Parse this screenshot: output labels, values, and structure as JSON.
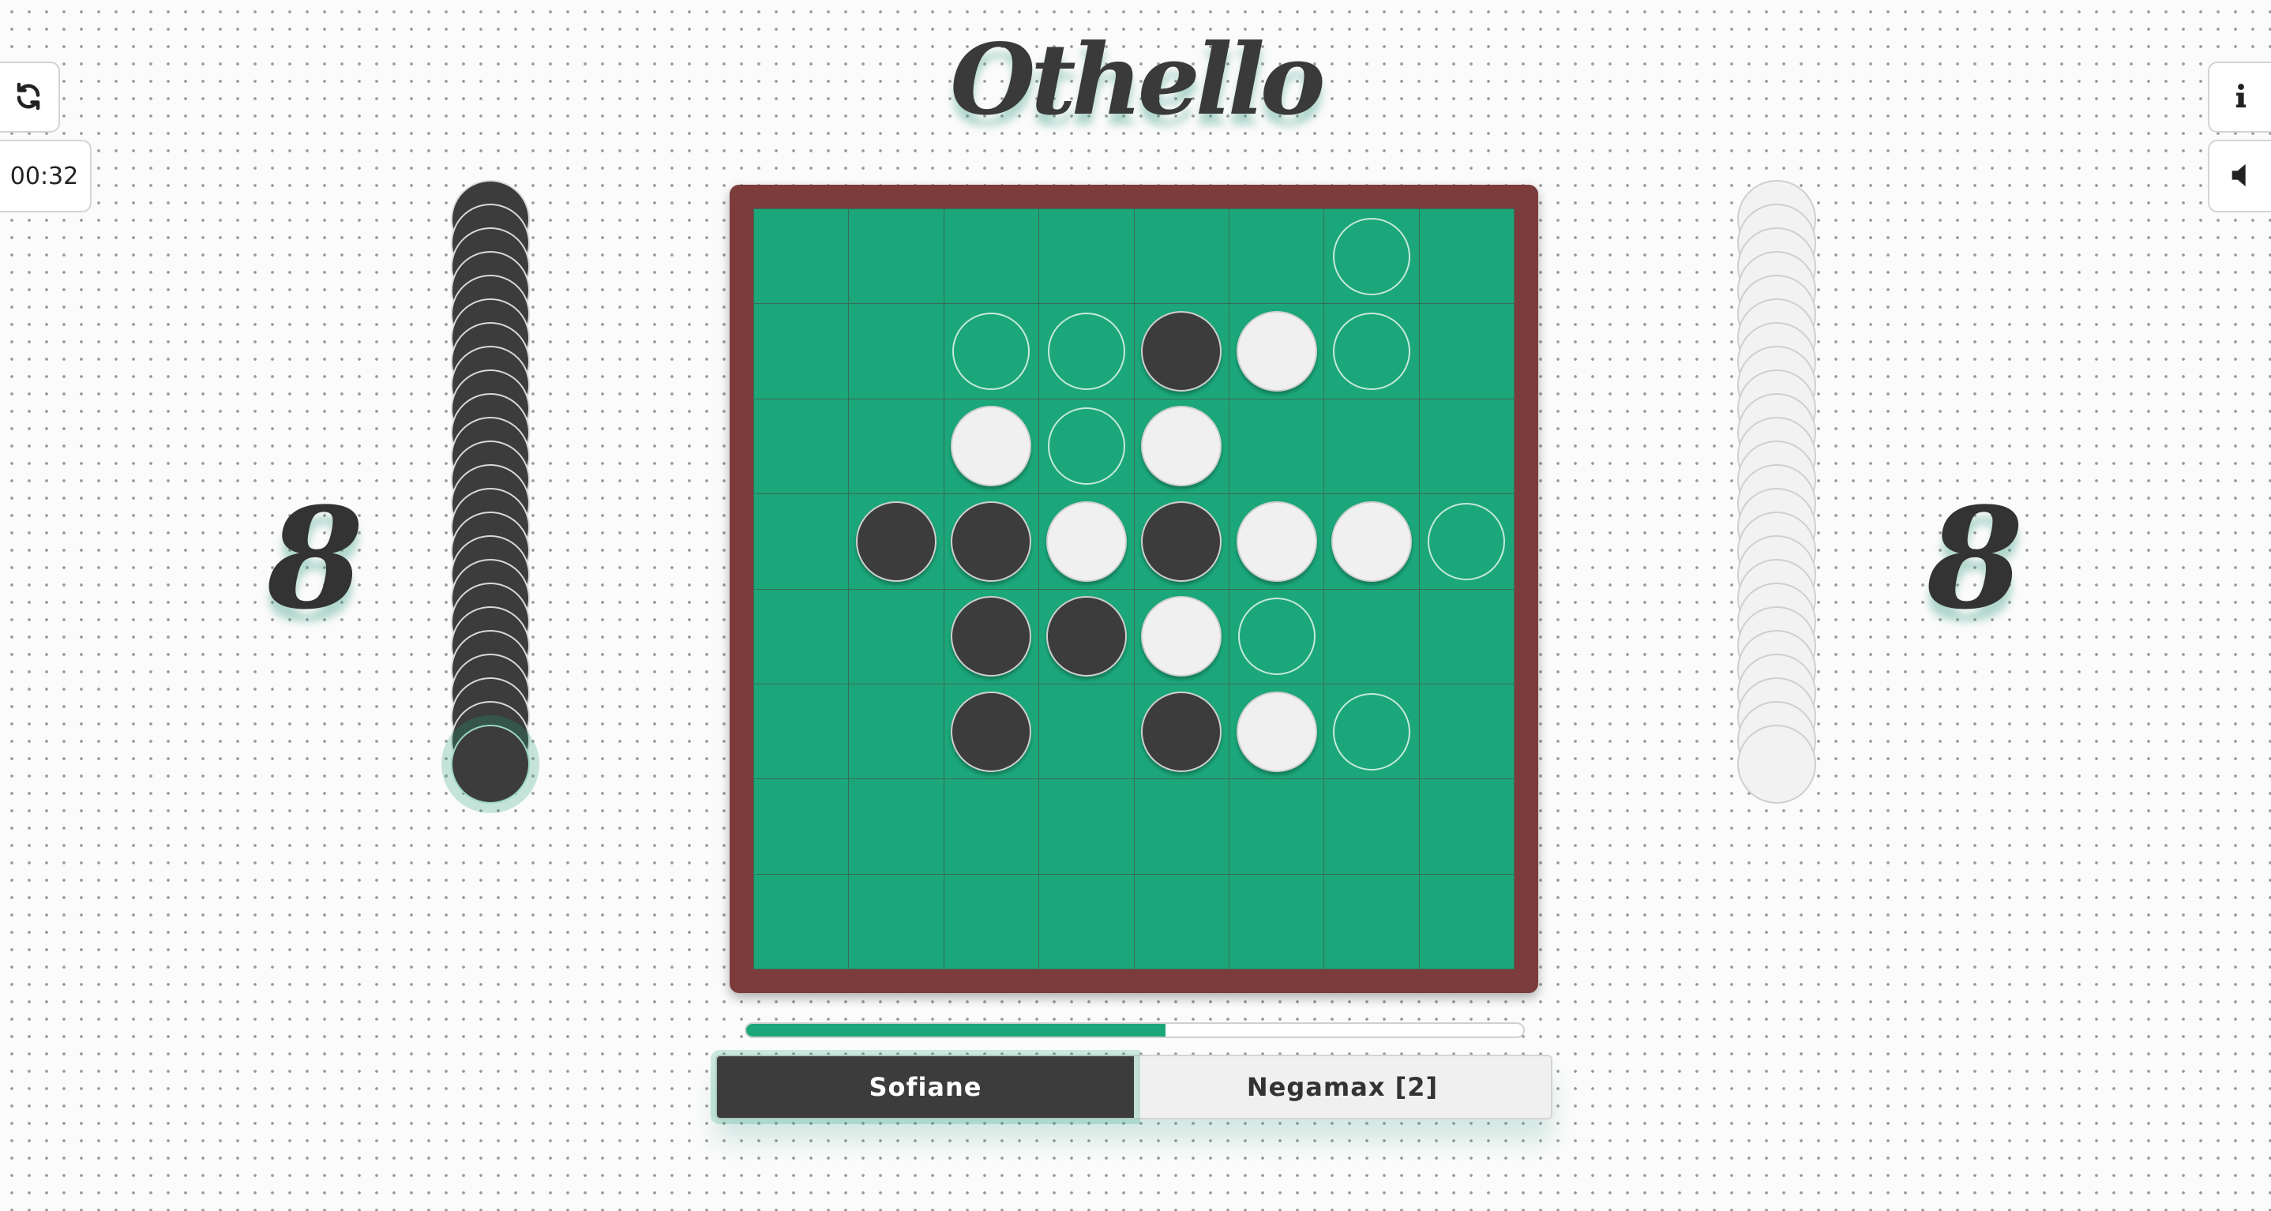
{
  "title": "Othello",
  "timer": "00:32",
  "icons": {
    "restart": "refresh-icon",
    "info": "info-icon",
    "sound": "speaker-icon"
  },
  "scores": {
    "black": "8",
    "white": "8"
  },
  "stacks": {
    "black_count": 24,
    "white_count": 24
  },
  "colors": {
    "board": "#1ba77a",
    "frame": "#7c3c3c",
    "black_disc": "#3c3c3c",
    "white_disc": "#f0f0f0",
    "accent": "#1ba77a"
  },
  "board": [
    [
      ".",
      ".",
      ".",
      ".",
      ".",
      ".",
      "h",
      "."
    ],
    [
      ".",
      ".",
      "h",
      "h",
      "B",
      "W",
      "h",
      "."
    ],
    [
      ".",
      ".",
      "W",
      "h",
      "W",
      ".",
      ".",
      "."
    ],
    [
      ".",
      "B",
      "B",
      "W",
      "B",
      "W",
      "W",
      "h"
    ],
    [
      ".",
      ".",
      "B",
      "B",
      "W",
      "h",
      ".",
      "."
    ],
    [
      ".",
      ".",
      "B",
      ".",
      "B",
      "W",
      "h",
      "."
    ],
    [
      ".",
      ".",
      ".",
      ".",
      ".",
      ".",
      ".",
      "."
    ],
    [
      ".",
      ".",
      ".",
      ".",
      ".",
      ".",
      ".",
      "."
    ]
  ],
  "progress": 0.54,
  "players": {
    "black": "Sofiane",
    "white": "Negamax [2]",
    "active": "black"
  }
}
